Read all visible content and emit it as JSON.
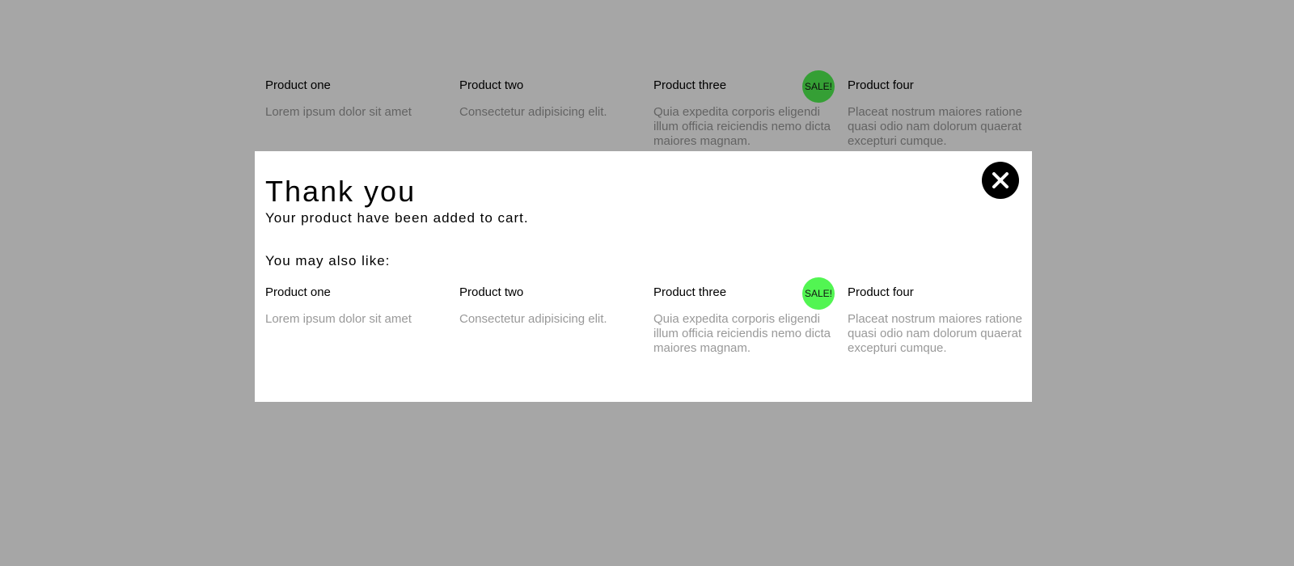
{
  "products": [
    {
      "name": "Product one",
      "description": "Lorem ipsum dolor sit amet"
    },
    {
      "name": "Product two",
      "description": "Consectetur adipisicing elit."
    },
    {
      "name": "Product three",
      "description": "Quia expedita corporis eligendi illum officia reiciendis nemo dicta maiores magnam.",
      "badge": "SALE!"
    },
    {
      "name": "Product four",
      "description": "Placeat nostrum maiores ratione quasi odio nam dolorum quaerat excepturi cumque."
    }
  ],
  "modal": {
    "title": "Thank you",
    "subtitle": "Your product have been added to cart.",
    "section_title": "You may also like:",
    "close_icon": "close-icon"
  },
  "colors": {
    "overlay": "#000000",
    "sale_badge": "#52f552",
    "description_text": "#999999",
    "close_button": "#000000"
  }
}
